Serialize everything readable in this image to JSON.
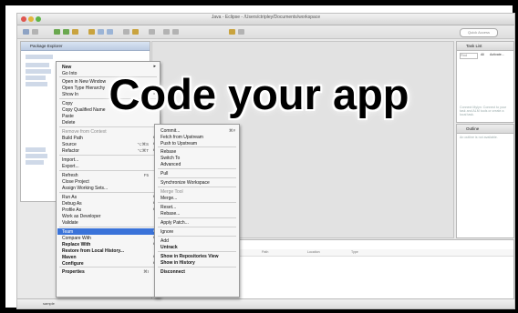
{
  "window": {
    "title": "Java - Eclipse - /Users/ctripley/Documents/workspace",
    "traffic_colors": [
      "#e0564f",
      "#e3b53c",
      "#5fb448"
    ]
  },
  "toolbar": {
    "quick_access_placeholder": "Quick Access"
  },
  "panes": {
    "package_explorer_tab": "Package Explorer",
    "task_list_tab": "Task List",
    "outline_tab": "Outline",
    "outline_msg": "An outline is not available.",
    "task_connect_msg": "Connect Mylyn: Connect to your task and ALM tools or create a local task.",
    "task_find_placeholder": "Find",
    "task_all_label": "All",
    "task_activate_label": "Activate...",
    "bottom_columns": [
      "Path",
      "Location",
      "Type"
    ]
  },
  "statusbar": {
    "text": "sample"
  },
  "overlay": {
    "headline": "Code your app"
  },
  "context_menu": {
    "items": [
      {
        "label": "New",
        "shortcut": "",
        "submenu": true,
        "style": "bold"
      },
      {
        "label": "Go Into",
        "shortcut": "",
        "submenu": false,
        "style": "normal"
      },
      {
        "label": "Open in New Window",
        "shortcut": "",
        "submenu": false,
        "style": "normal"
      },
      {
        "label": "Open Type Hierarchy",
        "shortcut": "F4",
        "submenu": false,
        "style": "normal"
      },
      {
        "label": "Show In",
        "shortcut": "",
        "submenu": true,
        "style": "normal"
      },
      {
        "label": "Copy",
        "shortcut": "",
        "submenu": false,
        "style": "normal"
      },
      {
        "label": "Copy Qualified Name",
        "shortcut": "",
        "submenu": false,
        "style": "normal"
      },
      {
        "label": "Paste",
        "shortcut": "",
        "submenu": false,
        "style": "normal"
      },
      {
        "label": "Delete",
        "shortcut": "",
        "submenu": false,
        "style": "normal"
      },
      {
        "label": "Remove from Context",
        "shortcut": "",
        "submenu": false,
        "style": "dim"
      },
      {
        "label": "Build Path",
        "shortcut": "",
        "submenu": true,
        "style": "normal"
      },
      {
        "label": "Source",
        "shortcut": "⌥⌘S",
        "submenu": true,
        "style": "normal"
      },
      {
        "label": "Refactor",
        "shortcut": "⌥⌘T",
        "submenu": true,
        "style": "normal"
      },
      {
        "label": "Import...",
        "shortcut": "",
        "submenu": false,
        "style": "normal"
      },
      {
        "label": "Export...",
        "shortcut": "",
        "submenu": false,
        "style": "normal"
      },
      {
        "label": "Refresh",
        "shortcut": "F5",
        "submenu": false,
        "style": "normal"
      },
      {
        "label": "Close Project",
        "shortcut": "",
        "submenu": false,
        "style": "normal"
      },
      {
        "label": "Assign Working Sets...",
        "shortcut": "",
        "submenu": false,
        "style": "normal"
      },
      {
        "label": "Run As",
        "shortcut": "",
        "submenu": true,
        "style": "normal"
      },
      {
        "label": "Debug As",
        "shortcut": "",
        "submenu": true,
        "style": "normal"
      },
      {
        "label": "Profile As",
        "shortcut": "",
        "submenu": true,
        "style": "normal"
      },
      {
        "label": "Work as Developer",
        "shortcut": "",
        "submenu": false,
        "style": "normal"
      },
      {
        "label": "Validate",
        "shortcut": "",
        "submenu": false,
        "style": "normal"
      },
      {
        "label": "Team",
        "shortcut": "",
        "submenu": true,
        "style": "selected"
      },
      {
        "label": "Compare With",
        "shortcut": "",
        "submenu": true,
        "style": "normal"
      },
      {
        "label": "Replace With",
        "shortcut": "",
        "submenu": true,
        "style": "bold"
      },
      {
        "label": "Restore from Local History...",
        "shortcut": "",
        "submenu": false,
        "style": "bold"
      },
      {
        "label": "Maven",
        "shortcut": "",
        "submenu": true,
        "style": "bold"
      },
      {
        "label": "Configure",
        "shortcut": "",
        "submenu": true,
        "style": "bold"
      },
      {
        "label": "Properties",
        "shortcut": "⌘I",
        "submenu": false,
        "style": "bold"
      }
    ]
  },
  "team_menu": {
    "items": [
      {
        "label": "Commit...",
        "shortcut": "⌘#",
        "style": "normal"
      },
      {
        "label": "Fetch from Upstream",
        "shortcut": "",
        "style": "normal"
      },
      {
        "label": "Push to Upstream",
        "shortcut": "",
        "style": "normal"
      },
      {
        "label": "Rebase",
        "shortcut": "",
        "style": "normal"
      },
      {
        "label": "Switch To",
        "shortcut": "",
        "style": "normal"
      },
      {
        "label": "Advanced",
        "shortcut": "",
        "style": "normal"
      },
      {
        "label": "Pull",
        "shortcut": "",
        "style": "normal"
      },
      {
        "label": "Synchronize Workspace",
        "shortcut": "",
        "style": "normal"
      },
      {
        "label": "Merge Tool",
        "shortcut": "",
        "style": "dim"
      },
      {
        "label": "Merge...",
        "shortcut": "",
        "style": "normal"
      },
      {
        "label": "Reset...",
        "shortcut": "",
        "style": "normal"
      },
      {
        "label": "Rebase...",
        "shortcut": "",
        "style": "normal"
      },
      {
        "label": "Apply Patch...",
        "shortcut": "",
        "style": "normal"
      },
      {
        "label": "Ignore",
        "shortcut": "",
        "style": "normal"
      },
      {
        "label": "Add",
        "shortcut": "",
        "style": "normal"
      },
      {
        "label": "Untrack",
        "shortcut": "",
        "style": "bold"
      },
      {
        "label": "Show in Repositories View",
        "shortcut": "",
        "style": "bold"
      },
      {
        "label": "Show in History",
        "shortcut": "",
        "style": "bold"
      },
      {
        "label": "Disconnect",
        "shortcut": "",
        "style": "bold"
      }
    ]
  }
}
